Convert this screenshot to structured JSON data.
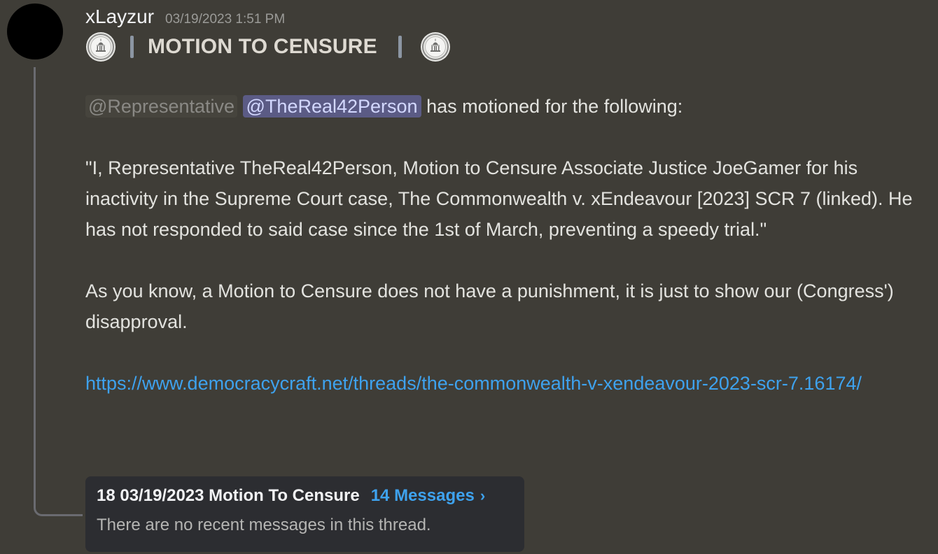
{
  "message": {
    "author": "xLayzur",
    "timestamp": "03/19/2023 1:51 PM",
    "heading": "MOTION TO CENSURE",
    "mention_role": "@Representative",
    "mention_user": "@TheReal42Person",
    "mention_suffix": " has motioned for the following:",
    "quote": "\"I, Representative TheReal42Person, Motion to Censure Associate Justice JoeGamer for his inactivity in the Supreme Court case, The Commonwealth v. xEndeavour [2023] SCR 7 (linked). He has not responded to said case since the 1st of March, preventing a speedy trial.\"",
    "note": "As you know, a Motion to Censure does not have a punishment, it is just to show our (Congress') disapproval.",
    "link": "https://www.democracycraft.net/threads/the-commonwealth-v-xendeavour-2023-scr-7.16174/",
    "icons": [
      "capitol-seal-icon",
      "capitol-seal-icon"
    ]
  },
  "thread": {
    "name": "18 03/19/2023 Motion To Censure",
    "count": "14 Messages",
    "chevron": "›",
    "empty_text": "There are no recent messages in this thread."
  },
  "colors": {
    "background": "#3f3d37",
    "link": "#3ea2ee",
    "mention_user_bg": "#5b5b85",
    "thread_card_bg": "#2c2d31"
  }
}
